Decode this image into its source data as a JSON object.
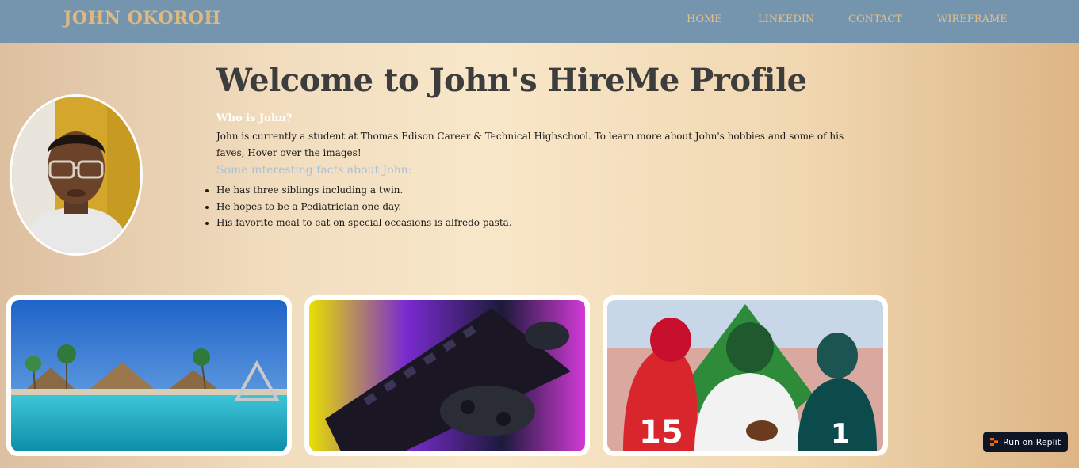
{
  "nav": {
    "brand": "JOHN OKOROH",
    "links": [
      "HOME",
      "LINKEDIN",
      "CONTACT",
      "WIREFRAME"
    ]
  },
  "profile": {
    "title": "Welcome to John's HireMe Profile",
    "who_heading": "Who is John?",
    "description": "John is currently a student at Thomas Edison Career & Technical Highschool. To learn more about John's hobbies and some of his faves, Hover over the images!",
    "facts_heading": "Some interesting facts about John:",
    "facts": [
      "He has three siblings including a twin.",
      "He hopes to be a Pediatrician one day.",
      "His favorite meal to eat on special occasions is alfredo pasta."
    ]
  },
  "cards": [
    {
      "icon": "resort-pool-image"
    },
    {
      "icon": "gaming-keyboard-controller-image"
    },
    {
      "icon": "football-players-image"
    }
  ],
  "replit": {
    "label": "Run on Replit",
    "icon": "replit-icon"
  },
  "colors": {
    "navbar": "#7594ad",
    "brand": "#e0b97e",
    "title": "#3d3d3d",
    "facts_heading": "#a9c0d6",
    "replit_bg": "#0e1525"
  }
}
